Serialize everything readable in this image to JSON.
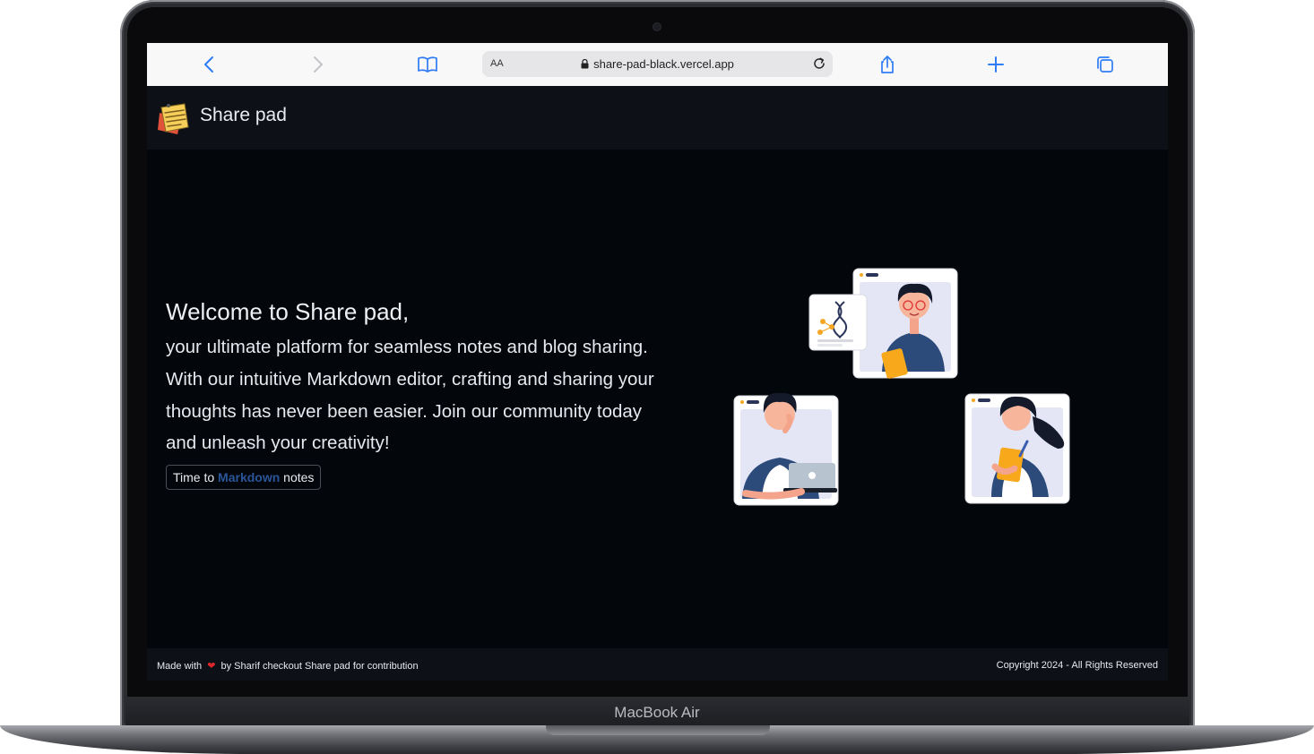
{
  "device": {
    "label": "MacBook Air"
  },
  "browser": {
    "address_prefix": "AA",
    "url": "share-pad-black.vercel.app",
    "icons": [
      "back-icon",
      "forward-icon",
      "bookmarks-icon",
      "lock-icon",
      "reload-icon",
      "share-icon",
      "new-tab-icon",
      "tabs-icon"
    ]
  },
  "navbar": {
    "title": "Share pad",
    "logo": "sticky-notes-logo"
  },
  "hero": {
    "heading": "Welcome to Share pad,",
    "body": "your ultimate platform for seamless notes and blog sharing. With our intuitive Markdown editor, crafting and sharing your thoughts has never been easier. Join our community today and unleash your creativity!",
    "cta": {
      "prefix": "Time to",
      "accent": "Markdown",
      "suffix": "notes"
    }
  },
  "footer": {
    "made_with": "Made with",
    "heart": "❤",
    "made_by": "by Sharif checkout Share pad for contribution",
    "copyright": "Copyright 2024 - All Rights Reserved"
  },
  "colors": {
    "page_bg": "#03060b",
    "bar_bg": "#0d1117",
    "accent": "#2a5598",
    "heart": "#e0262d"
  }
}
